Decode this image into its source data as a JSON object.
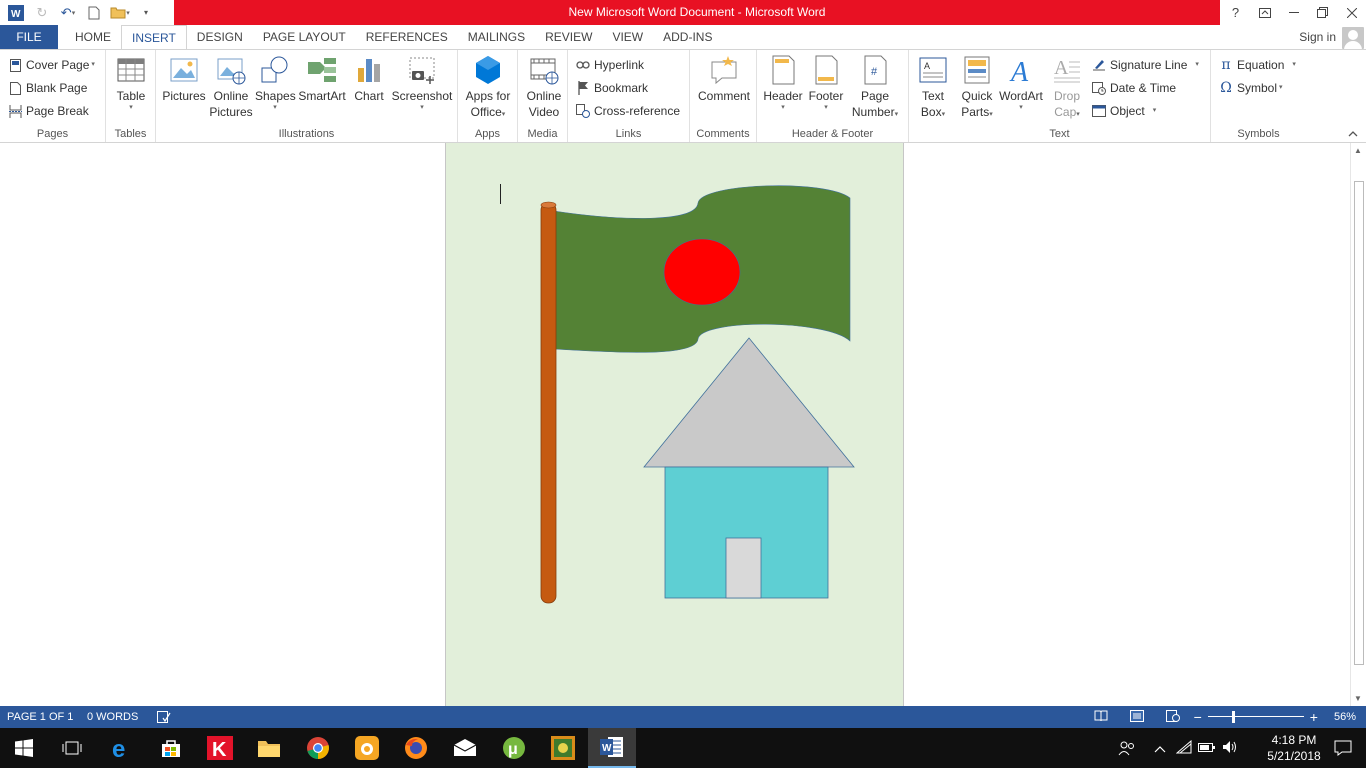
{
  "window": {
    "title": "New Microsoft Word Document - Microsoft Word",
    "help": "?"
  },
  "tabs": {
    "file": "FILE",
    "items": [
      "HOME",
      "INSERT",
      "DESIGN",
      "PAGE LAYOUT",
      "REFERENCES",
      "MAILINGS",
      "REVIEW",
      "VIEW",
      "ADD-INS"
    ],
    "active": "INSERT",
    "sign_in": "Sign in"
  },
  "ribbon": {
    "pages": {
      "name": "Pages",
      "cover_page": "Cover Page",
      "blank_page": "Blank Page",
      "page_break": "Page Break"
    },
    "tables": {
      "name": "Tables",
      "table": "Table"
    },
    "illustrations": {
      "name": "Illustrations",
      "pictures": "Pictures",
      "online_pictures_1": "Online",
      "online_pictures_2": "Pictures",
      "shapes": "Shapes",
      "smartart": "SmartArt",
      "chart": "Chart",
      "screenshot": "Screenshot"
    },
    "apps": {
      "name": "Apps",
      "apps_for_office_1": "Apps for",
      "apps_for_office_2": "Office"
    },
    "media": {
      "name": "Media",
      "online_video_1": "Online",
      "online_video_2": "Video"
    },
    "links": {
      "name": "Links",
      "hyperlink": "Hyperlink",
      "bookmark": "Bookmark",
      "cross_reference": "Cross-reference"
    },
    "comments": {
      "name": "Comments",
      "comment": "Comment"
    },
    "header_footer": {
      "name": "Header & Footer",
      "header": "Header",
      "footer": "Footer",
      "page_number_1": "Page",
      "page_number_2": "Number"
    },
    "text": {
      "name": "Text",
      "text_box_1": "Text",
      "text_box_2": "Box",
      "quick_parts_1": "Quick",
      "quick_parts_2": "Parts",
      "wordart": "WordArt",
      "drop_cap_1": "Drop",
      "drop_cap_2": "Cap",
      "signature_line": "Signature Line",
      "date_time": "Date & Time",
      "object": "Object"
    },
    "symbols": {
      "name": "Symbols",
      "equation": "Equation",
      "symbol": "Symbol"
    }
  },
  "document": {
    "page_color": "#e2efda",
    "flag_color": "#548235",
    "disc_color": "#ff0000",
    "pole_color": "#c55a11",
    "roof_color": "#c9c9c9",
    "wall_color": "#5ecfd3",
    "door_color": "#d9d9d9"
  },
  "status": {
    "page": "PAGE 1 OF 1",
    "words": "0 WORDS",
    "zoom": "56%"
  },
  "taskbar": {
    "time": "4:18 PM",
    "date": "5/21/2018"
  }
}
